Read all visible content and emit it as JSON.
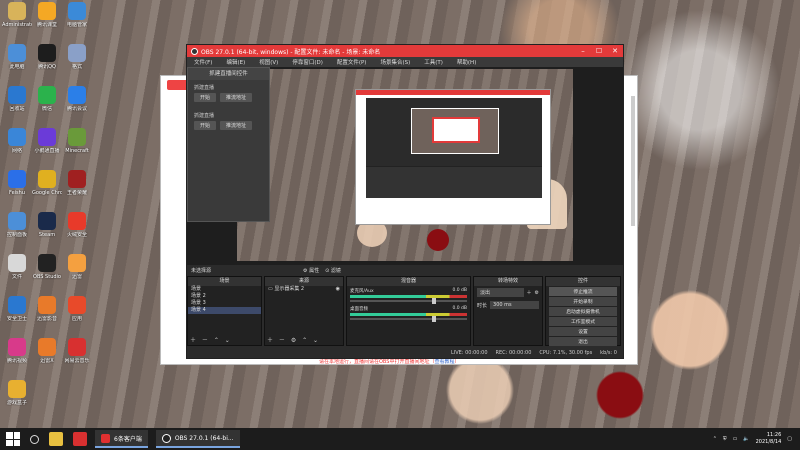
{
  "desktop": {
    "icons": [
      {
        "label": "Administrator",
        "color": "#d8b35a"
      },
      {
        "label": "腾讯课堂",
        "color": "#f4a824"
      },
      {
        "label": "电脑管家",
        "color": "#3b8ad8"
      },
      {
        "label": "此电脑",
        "color": "#4c8fd8"
      },
      {
        "label": "腾讯QQ",
        "color": "#1d1d1d"
      },
      {
        "label": "格式",
        "color": "#8aa0c8"
      },
      {
        "label": "回收站",
        "color": "#2a78d0"
      },
      {
        "label": "微信",
        "color": "#2bb24c"
      },
      {
        "label": "腾讯会议",
        "color": "#2b7fe8"
      },
      {
        "label": "网络",
        "color": "#3a86d8"
      },
      {
        "label": "小鹅通直播",
        "color": "#6b3bd8"
      },
      {
        "label": "Minecraft",
        "color": "#6a9a3a"
      },
      {
        "label": "Feishu",
        "color": "#2b6fe8"
      },
      {
        "label": "Google Chrome",
        "color": "#e0b020"
      },
      {
        "label": "王者荣耀",
        "color": "#a02020"
      },
      {
        "label": "控制面板",
        "color": "#4c8fd8"
      },
      {
        "label": "Steam",
        "color": "#1a2a4a"
      },
      {
        "label": "火绒安全",
        "color": "#e83a2a"
      },
      {
        "label": "文件",
        "color": "#d8d8d8"
      },
      {
        "label": "OBS Studio",
        "color": "#222222"
      },
      {
        "label": "迅雷",
        "color": "#f4a040"
      },
      {
        "label": "安全卫士",
        "color": "#2a78d0"
      },
      {
        "label": "迅雷影音",
        "color": "#e87a2a"
      },
      {
        "label": "应用",
        "color": "#e84a2a"
      },
      {
        "label": "腾讯视频",
        "color": "#d83a8a"
      },
      {
        "label": "迅雷X",
        "color": "#e87a2a"
      },
      {
        "label": "网易云音乐",
        "color": "#d83030"
      },
      {
        "label": "游戏盒子",
        "color": "#e8b030"
      }
    ]
  },
  "bg_app": {
    "notice": "请在本地运行，直播间请在OBS中打开直播间地址（",
    "notice_link": "查看教程",
    "notice_end": "）"
  },
  "obs": {
    "title": "OBS 27.0.1 (64-bit, windows) - 配置文件: 未命名 - 场景: 未命名",
    "menu": [
      "文件(F)",
      "编辑(E)",
      "视图(V)",
      "停靠窗口(D)",
      "配置文件(P)",
      "场景集合(S)",
      "工具(T)",
      "帮助(H)"
    ],
    "popup": {
      "header": "抓建直播间控件",
      "groups": [
        {
          "label": "抓建直播",
          "start": "开始",
          "address": "推流地址"
        },
        {
          "label": "抓建直播",
          "start": "开始",
          "address": "推流地址"
        }
      ]
    },
    "dock_header": {
      "selection": "未选择源",
      "properties": "属性",
      "filters": "滤镜"
    },
    "scenes": {
      "header": "场景",
      "items": [
        "场景",
        "场景 2",
        "场景 3",
        "场景 4"
      ],
      "selected": 3
    },
    "sources": {
      "header": "来源",
      "items": [
        "显示器采集 2"
      ]
    },
    "mixer": {
      "header": "混音器",
      "channels": [
        {
          "name": "麦克风/Aux",
          "db": "0.0 dB"
        },
        {
          "name": "桌面音频",
          "db": "0.0 dB"
        }
      ]
    },
    "transitions": {
      "header": "转场特效",
      "type": "淡出",
      "duration_label": "时长",
      "duration": "300 ms"
    },
    "controls": {
      "header": "控件",
      "buttons": [
        "停止推流",
        "开始录制",
        "启动虚拟摄像机",
        "工作室模式",
        "设置",
        "退出"
      ]
    },
    "status": {
      "live": "LIVE: 00:00:00",
      "rec": "REC: 00:00:00",
      "cpu": "CPU: 7.1%, 30.00 fps",
      "kbps": "kb/s: 0"
    }
  },
  "taskbar": {
    "tasks": [
      {
        "label": "6条客户端",
        "color": "#e03030"
      },
      {
        "label": "OBS 27.0.1 (64-bi...",
        "color": "#222222"
      }
    ],
    "time": "11:26",
    "date": "2021/8/14"
  }
}
